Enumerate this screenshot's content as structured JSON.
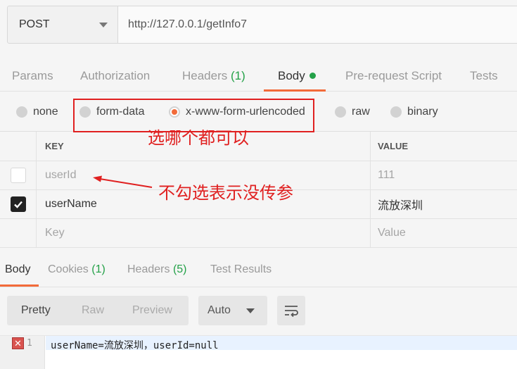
{
  "request": {
    "method": "POST",
    "url": "http://127.0.0.1/getInfo7"
  },
  "tabs": {
    "params": "Params",
    "authorization": "Authorization",
    "headers": "Headers",
    "headers_count": "(1)",
    "body": "Body",
    "prerequest": "Pre-request Script",
    "tests": "Tests"
  },
  "body_types": {
    "none": "none",
    "form_data": "form-data",
    "urlencoded": "x-www-form-urlencoded",
    "raw": "raw",
    "binary": "binary",
    "selected": "x-www-form-urlencoded"
  },
  "table": {
    "key_header": "KEY",
    "value_header": "VALUE",
    "rows": [
      {
        "key": "userId",
        "value": "111",
        "checked": false
      },
      {
        "key": "userName",
        "value": "流放深圳",
        "checked": true
      }
    ],
    "key_placeholder": "Key",
    "value_placeholder": "Value"
  },
  "response": {
    "tabs": {
      "body": "Body",
      "cookies": "Cookies",
      "cookies_count": "(1)",
      "headers": "Headers",
      "headers_count": "(5)",
      "test_results": "Test Results"
    },
    "formats": {
      "pretty": "Pretty",
      "raw": "Raw",
      "preview": "Preview"
    },
    "language": "Auto",
    "line_number": "1",
    "error_marker": "✕",
    "code_line": "userName=流放深圳，userId=null"
  },
  "annotations": {
    "either_works": "选哪个都可以",
    "unchecked_means": "不勾选表示没传参"
  },
  "colors": {
    "accent": "#f26b3a",
    "count_green": "#24a148",
    "annotation_red": "#e02020"
  }
}
